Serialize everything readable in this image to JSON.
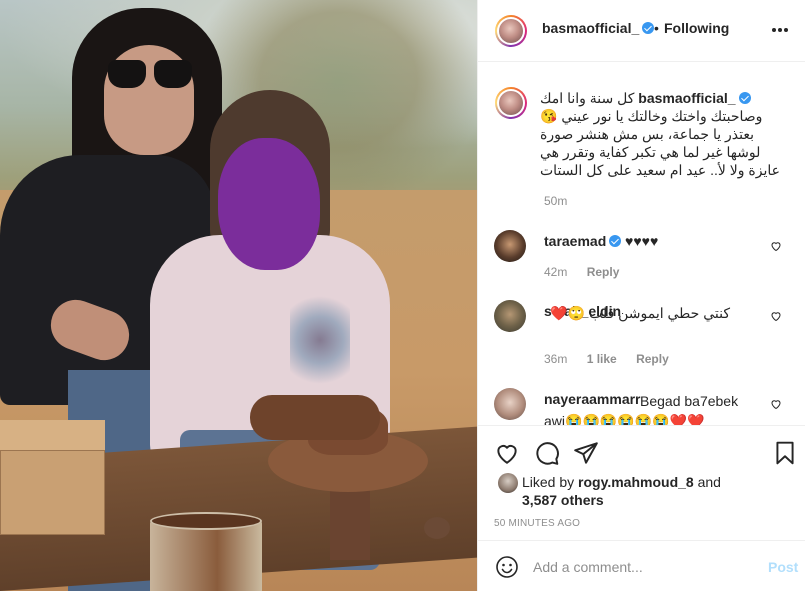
{
  "header": {
    "username": "basmaofficial_",
    "dot": "•",
    "follow_status": "Following"
  },
  "caption": {
    "username": "basmaofficial_",
    "text": "كل سنة وانا امك وصاحبتك واختك وخالتك يا نور عيني 😘 بعتذر يا جماعة، بس مش هنشر صورة لوشها غير لما هي تكبر كفاية وتقرر هي عايزة ولا لأ.. عيد ام سعيد على كل الستات",
    "time": "50m"
  },
  "comments": [
    {
      "username": "taraemad",
      "verified": true,
      "text": "♥♥♥♥",
      "time": "42m",
      "likes": "",
      "reply": "Reply"
    },
    {
      "username": "solah_eldin",
      "verified": false,
      "text": "كنتي حطي ايموشن قلب 🙄❤️",
      "time": "36m",
      "likes": "1 like",
      "reply": "Reply"
    },
    {
      "username": "nayeraammarr",
      "verified": false,
      "text": "Begad ba7ebek awi😭😭😭😭😭😭❤️❤️",
      "time": "",
      "likes": "",
      "reply": ""
    }
  ],
  "likes": {
    "liked_by_prefix": "Liked by",
    "liked_by_user": "rogy.mahmoud_8",
    "and": "and",
    "others": "3,587 others"
  },
  "post_time": "50 MINUTES AGO",
  "add_comment": {
    "placeholder": "Add a comment...",
    "post_label": "Post"
  },
  "colors": {
    "verified": "#3897f0",
    "heart_red": "#ed4956",
    "post_disabled": "#b2dffc",
    "face_blur": "#7b2d9b"
  }
}
